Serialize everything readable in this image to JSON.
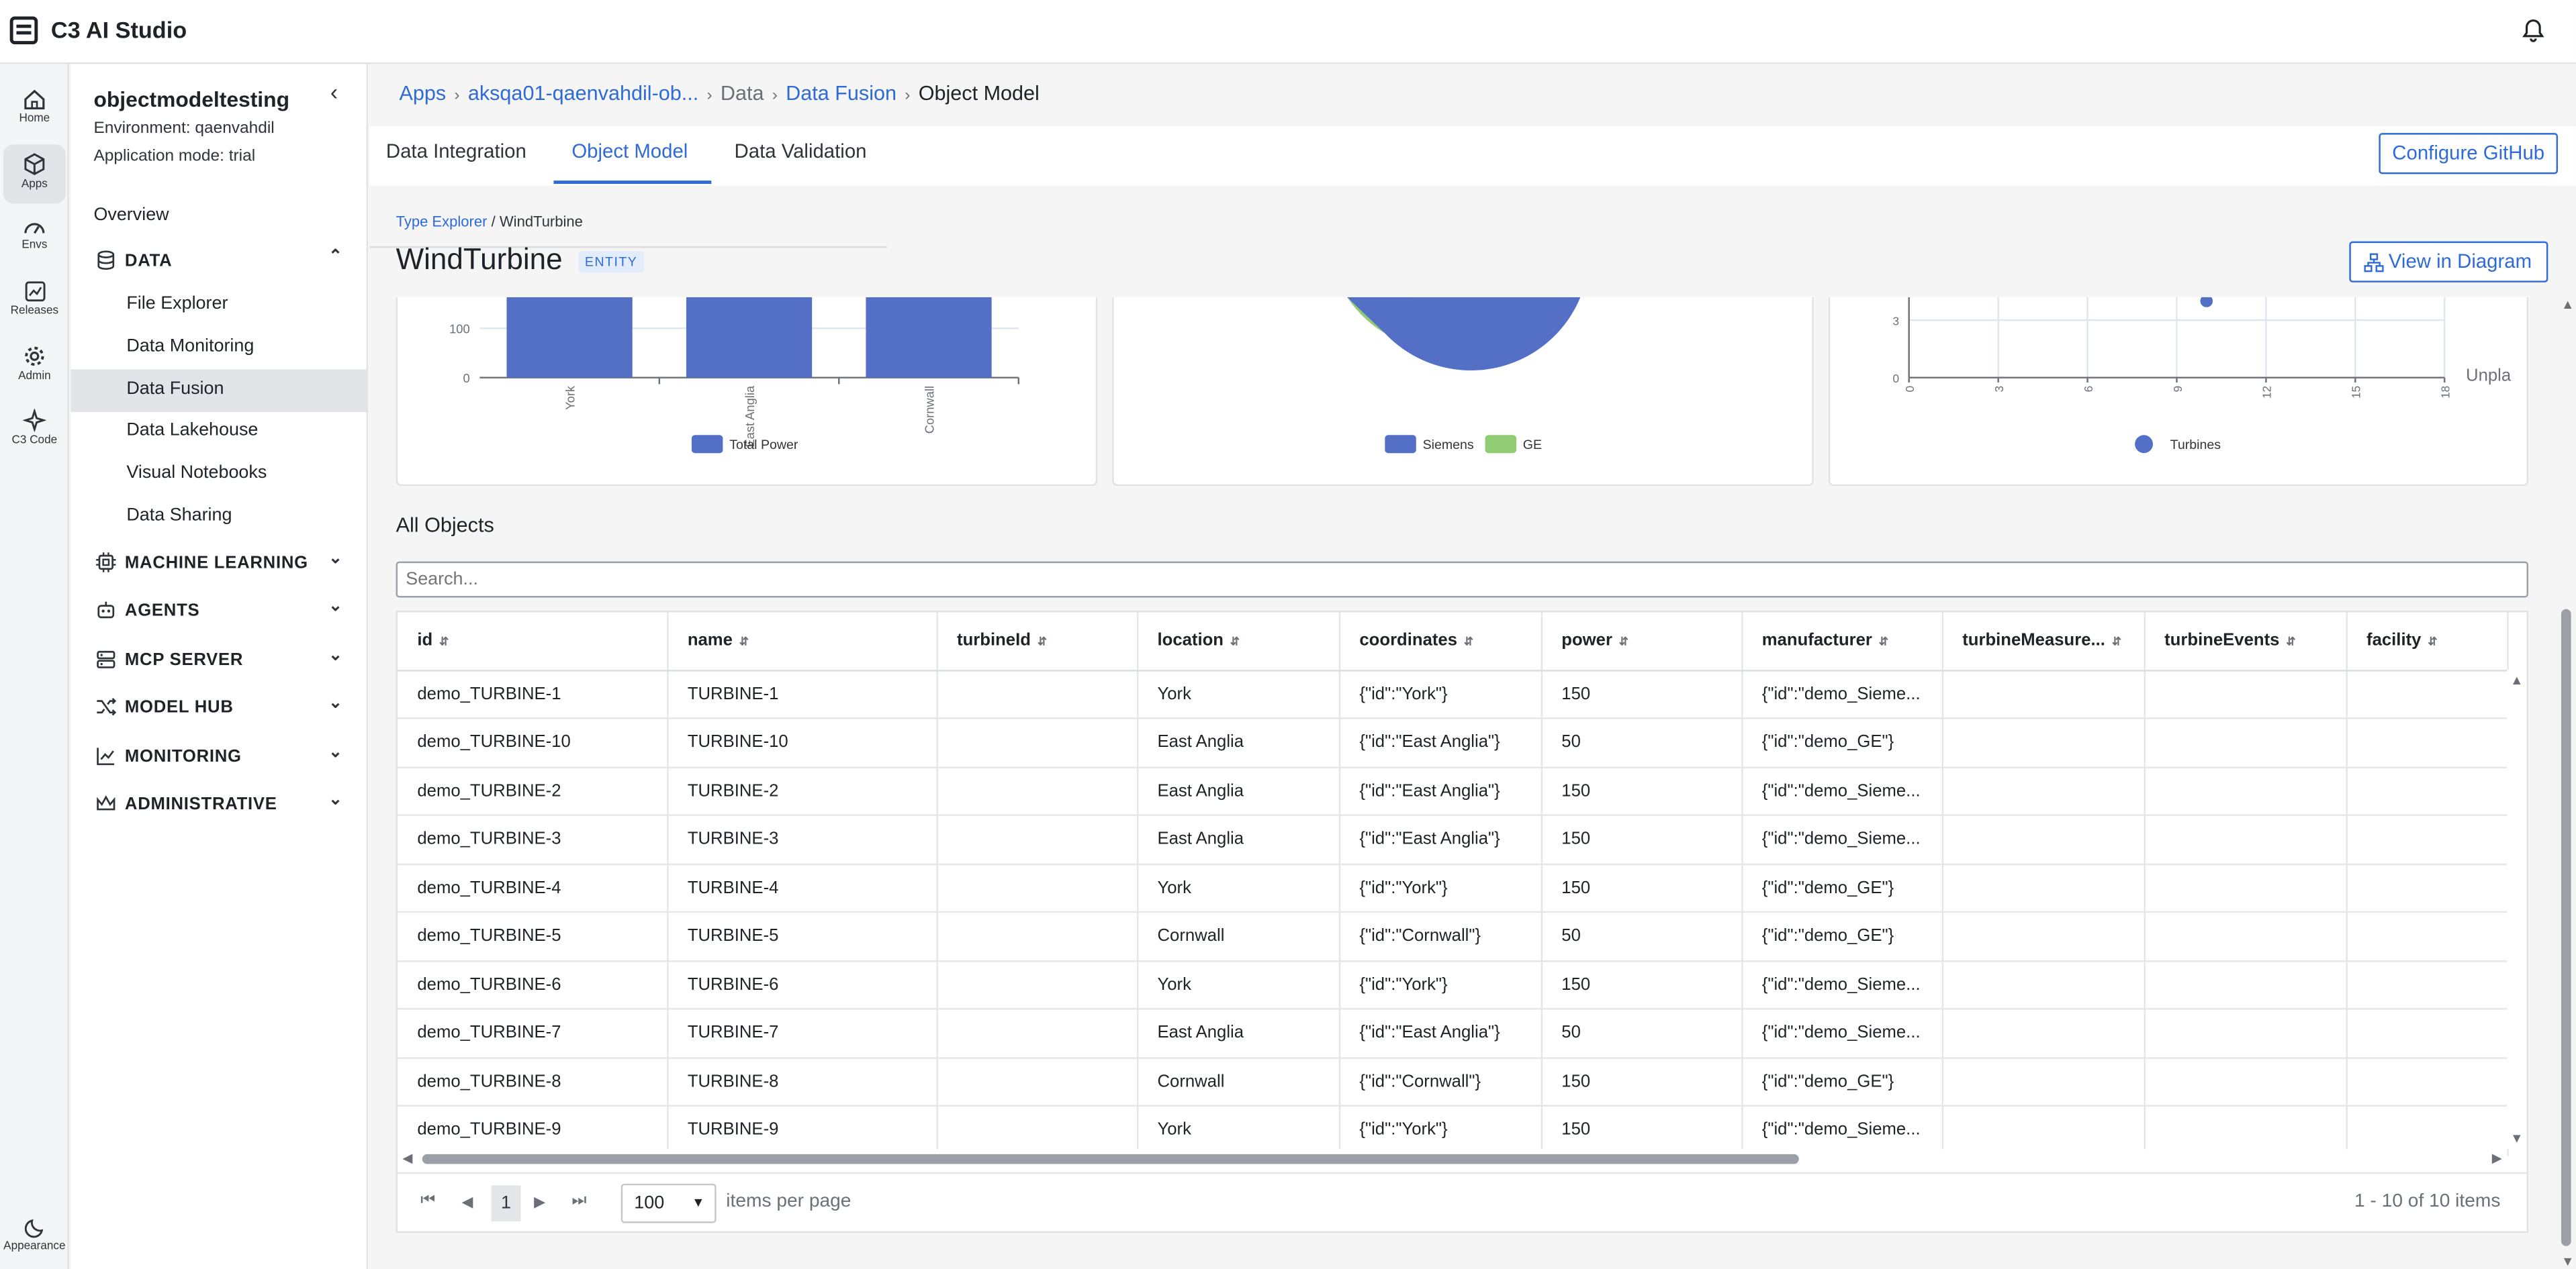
{
  "app": {
    "title": "C3 AI Studio"
  },
  "rail": [
    {
      "label": "Home",
      "icon": "home-icon"
    },
    {
      "label": "Apps",
      "icon": "box-icon"
    },
    {
      "label": "Envs",
      "icon": "gauge-icon"
    },
    {
      "label": "Releases",
      "icon": "releases-icon"
    },
    {
      "label": "Admin",
      "icon": "gear-icon"
    },
    {
      "label": "C3 Code",
      "icon": "sparkle-icon"
    }
  ],
  "rail_bottom": {
    "label": "Appearance",
    "icon": "moon-icon"
  },
  "sidenav": {
    "app_name": "objectmodeltesting",
    "environment": "Environment: qaenvahdil",
    "mode": "Application mode: trial",
    "overview": "Overview",
    "data_section": "DATA",
    "data_items": [
      "File Explorer",
      "Data Monitoring",
      "Data Fusion",
      "Data Lakehouse",
      "Visual Notebooks",
      "Data Sharing"
    ],
    "sections": [
      "MACHINE LEARNING",
      "AGENTS",
      "MCP SERVER",
      "MODEL HUB",
      "MONITORING",
      "ADMINISTRATIVE"
    ]
  },
  "breadcrumb": {
    "apps": "Apps",
    "app": "aksqa01-qaenvahdil-ob...",
    "data": "Data",
    "fusion": "Data Fusion",
    "current": "Object Model"
  },
  "tabs": [
    "Data Integration",
    "Object Model",
    "Data Validation"
  ],
  "configure_github": "Configure GitHub",
  "type_explorer": "Type Explorer",
  "type_sep": "/",
  "type_name": "WindTurbine",
  "entity_title": "WindTurbine",
  "entity_badge": "ENTITY",
  "view_diagram": "View in Diagram",
  "charts": [
    {
      "type": "bar",
      "categories": [
        "York",
        "East Anglia",
        "Cornwall"
      ],
      "y_ticks": [
        "0",
        "100"
      ],
      "legend": "Total Power",
      "color": "#5470c6"
    },
    {
      "type": "pie",
      "legend": [
        "Siemens",
        "GE"
      ],
      "colors": [
        "#5470c6",
        "#91cc75"
      ]
    },
    {
      "type": "scatter",
      "x_ticks": [
        "0",
        "3",
        "6",
        "9",
        "12",
        "15",
        "18"
      ],
      "y_ticks": [
        "0",
        "3"
      ],
      "points": [
        {
          "x": 10,
          "y": 4
        }
      ],
      "side_label": "Unpla",
      "legend": "Turbines",
      "color": "#5470c6"
    }
  ],
  "all_objects": "All Objects",
  "search": {
    "placeholder": "Search..."
  },
  "table": {
    "columns": [
      "id",
      "name",
      "turbineId",
      "location",
      "coordinates",
      "power",
      "manufacturer",
      "turbineMeasure...",
      "turbineEvents",
      "facility"
    ],
    "rows": [
      [
        "demo_TURBINE-1",
        "TURBINE-1",
        "",
        "York",
        "{\"id\":\"York\"}",
        "150",
        "{\"id\":\"demo_Sieme...",
        "",
        "",
        ""
      ],
      [
        "demo_TURBINE-10",
        "TURBINE-10",
        "",
        "East Anglia",
        "{\"id\":\"East Anglia\"}",
        "50",
        "{\"id\":\"demo_GE\"}",
        "",
        "",
        ""
      ],
      [
        "demo_TURBINE-2",
        "TURBINE-2",
        "",
        "East Anglia",
        "{\"id\":\"East Anglia\"}",
        "150",
        "{\"id\":\"demo_Sieme...",
        "",
        "",
        ""
      ],
      [
        "demo_TURBINE-3",
        "TURBINE-3",
        "",
        "East Anglia",
        "{\"id\":\"East Anglia\"}",
        "150",
        "{\"id\":\"demo_Sieme...",
        "",
        "",
        ""
      ],
      [
        "demo_TURBINE-4",
        "TURBINE-4",
        "",
        "York",
        "{\"id\":\"York\"}",
        "150",
        "{\"id\":\"demo_GE\"}",
        "",
        "",
        ""
      ],
      [
        "demo_TURBINE-5",
        "TURBINE-5",
        "",
        "Cornwall",
        "{\"id\":\"Cornwall\"}",
        "50",
        "{\"id\":\"demo_GE\"}",
        "",
        "",
        ""
      ],
      [
        "demo_TURBINE-6",
        "TURBINE-6",
        "",
        "York",
        "{\"id\":\"York\"}",
        "150",
        "{\"id\":\"demo_Sieme...",
        "",
        "",
        ""
      ],
      [
        "demo_TURBINE-7",
        "TURBINE-7",
        "",
        "East Anglia",
        "{\"id\":\"East Anglia\"}",
        "50",
        "{\"id\":\"demo_Sieme...",
        "",
        "",
        ""
      ],
      [
        "demo_TURBINE-8",
        "TURBINE-8",
        "",
        "Cornwall",
        "{\"id\":\"Cornwall\"}",
        "150",
        "{\"id\":\"demo_GE\"}",
        "",
        "",
        ""
      ],
      [
        "demo_TURBINE-9",
        "TURBINE-9",
        "",
        "York",
        "{\"id\":\"York\"}",
        "150",
        "{\"id\":\"demo_Sieme...",
        "",
        "",
        ""
      ]
    ]
  },
  "pagination": {
    "page": "1",
    "page_size": "100",
    "items_per_page": "items per page",
    "summary": "1 - 10 of 10 items"
  }
}
